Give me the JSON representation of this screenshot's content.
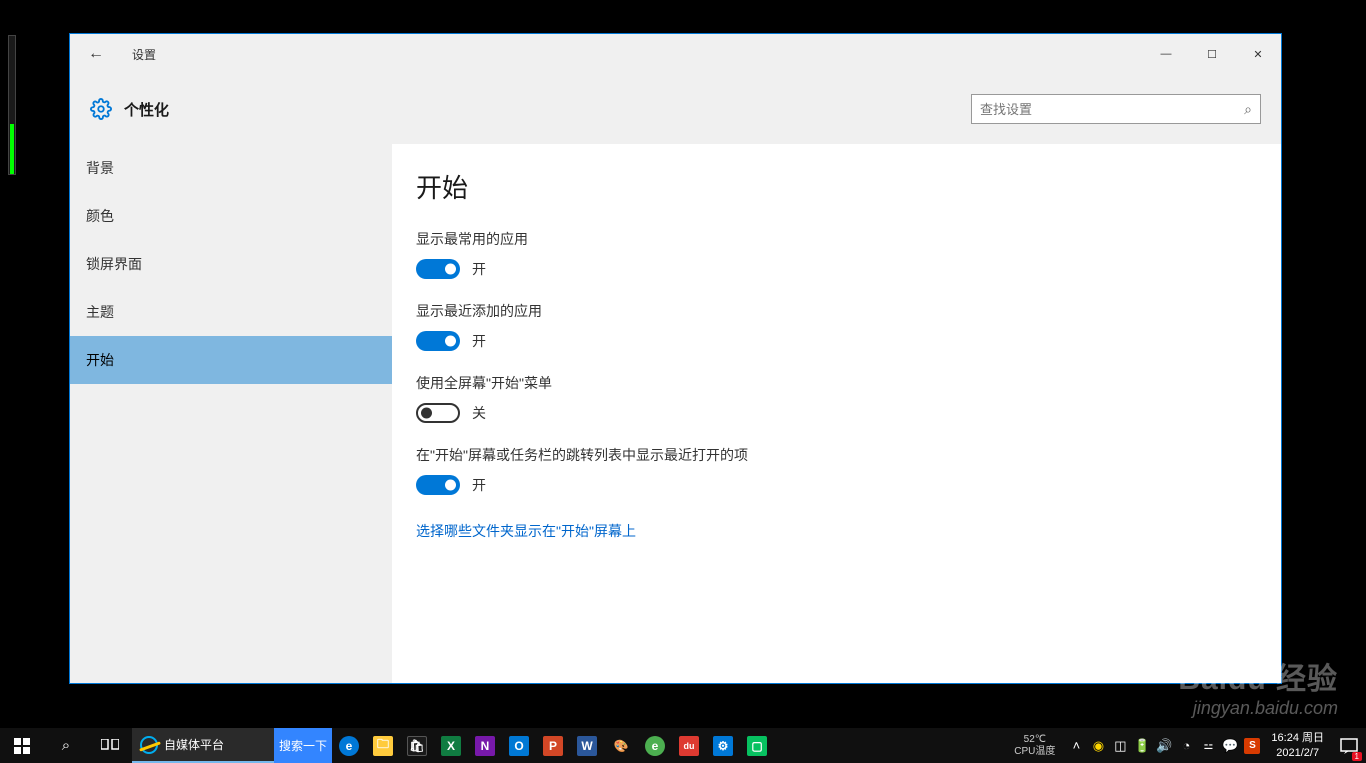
{
  "window": {
    "title": "设置",
    "section": "个性化",
    "search_placeholder": "查找设置"
  },
  "sidebar": {
    "items": [
      {
        "label": "背景"
      },
      {
        "label": "颜色"
      },
      {
        "label": "锁屏界面"
      },
      {
        "label": "主题"
      },
      {
        "label": "开始"
      }
    ]
  },
  "content": {
    "title": "开始",
    "settings": [
      {
        "label": "显示最常用的应用",
        "on": true,
        "state_text": "开"
      },
      {
        "label": "显示最近添加的应用",
        "on": true,
        "state_text": "开"
      },
      {
        "label": "使用全屏幕\"开始\"菜单",
        "on": false,
        "state_text": "关"
      },
      {
        "label": "在\"开始\"屏幕或任务栏的跳转列表中显示最近打开的项",
        "on": true,
        "state_text": "开"
      }
    ],
    "link": "选择哪些文件夹显示在\"开始\"屏幕上"
  },
  "taskbar": {
    "ie_title": "自媒体平台",
    "baidu_btn": "搜索一下",
    "cpu_temp": "52℃",
    "cpu_label": "CPU温度",
    "time": "16:24",
    "day": "周日",
    "date": "2021/2/7",
    "notif_count": "1"
  },
  "watermark": {
    "big": "Baidu 经验",
    "small": "jingyan.baidu.com"
  }
}
